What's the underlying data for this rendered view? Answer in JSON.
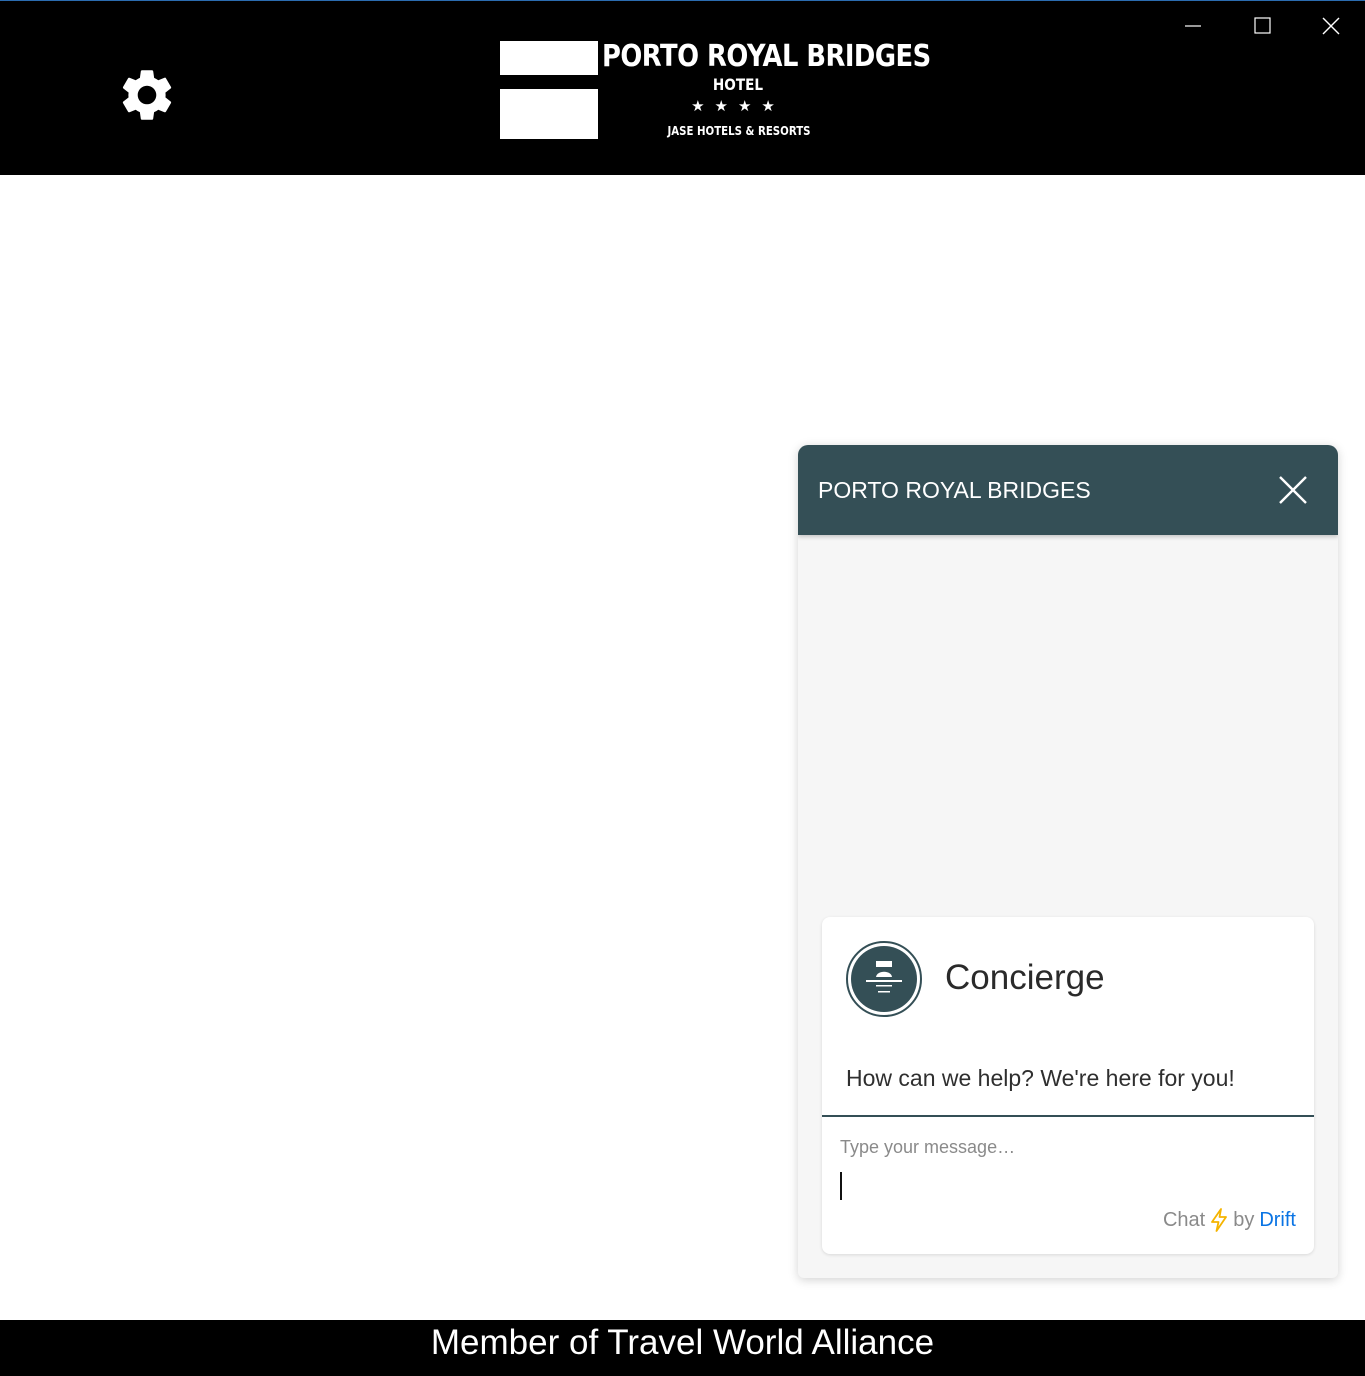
{
  "header": {
    "settings_icon": "gear-icon",
    "logo": {
      "title": "PORTO ROYAL BRIDGES",
      "subtitle": "HOTEL",
      "stars": "★★★★",
      "brand": "JASE HOTELS & RESORTS"
    },
    "window_controls": [
      "minimize-icon",
      "maximize-icon",
      "close-icon"
    ]
  },
  "chat": {
    "title": "PORTO ROYAL BRIDGES",
    "close_icon": "close-icon",
    "agent_name": "Concierge",
    "greeting": "How can we help? We're here for you!",
    "input_placeholder": "Type your message…",
    "branding": {
      "prefix": "Chat",
      "bolt_icon": "lightning-icon",
      "by": "by",
      "provider": "Drift"
    },
    "colors": {
      "header": "#344f56",
      "provider_link": "#0a74e4",
      "bolt": "#f5b400"
    }
  },
  "footer": {
    "text": "Member of Travel World Alliance"
  }
}
